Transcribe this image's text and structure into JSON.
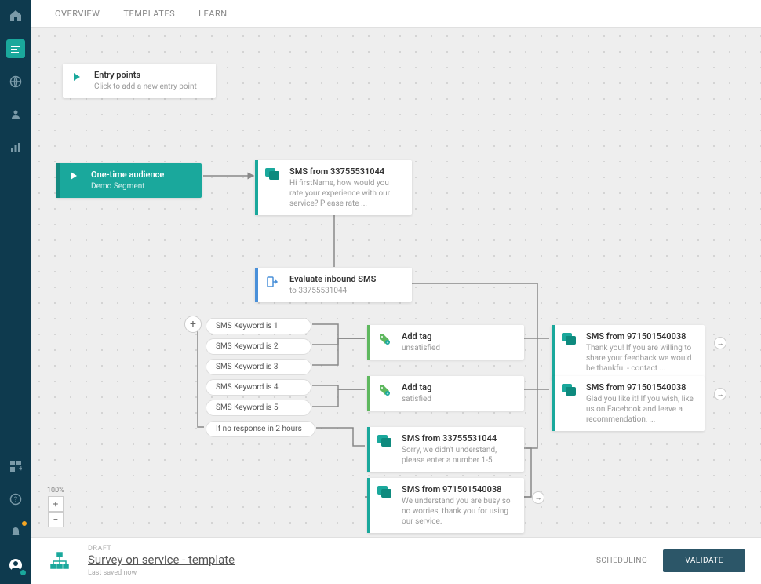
{
  "sidebar": {
    "icon_names": [
      "home",
      "flow",
      "globe",
      "users",
      "analytics"
    ],
    "bottom_icon_names": [
      "apps",
      "help",
      "notifications",
      "profile"
    ]
  },
  "tabs": [
    "OVERVIEW",
    "TEMPLATES",
    "LEARN"
  ],
  "entry_points": {
    "title": "Entry points",
    "subtitle": "Click to add a new entry point"
  },
  "nodes": {
    "audience": {
      "title": "One-time audience",
      "subtitle": "Demo Segment"
    },
    "sms1": {
      "title": "SMS from 33755531044",
      "subtitle": "Hi firstName, how would you rate your experience with our service? Please rate ..."
    },
    "evaluate": {
      "title": "Evaluate inbound SMS",
      "subtitle": "to 33755531044"
    },
    "tag1": {
      "title": "Add tag",
      "subtitle": "unsatisfied"
    },
    "tag2": {
      "title": "Add tag",
      "subtitle": "satisfied"
    },
    "sms2": {
      "title": "SMS from 971501540038",
      "subtitle": "Thank you! If you are willing to share your feedback we would be thankful - contact ..."
    },
    "sms3": {
      "title": "SMS from 971501540038",
      "subtitle": "Glad you like it! If you wish, like us on Facebook and leave a recommendation, ..."
    },
    "sms4": {
      "title": "SMS from 33755531044",
      "subtitle": "Sorry, we didn't understand, please enter a number 1-5."
    },
    "sms5": {
      "title": "SMS from 971501540038",
      "subtitle": "We understand you are busy so no worries, thank you for using our service."
    }
  },
  "branches": {
    "k1": "SMS Keyword is 1",
    "k2": "SMS Keyword is 2",
    "k3": "SMS Keyword is 3",
    "k4": "SMS Keyword is 4",
    "k5": "SMS Keyword is 5",
    "nores": "If no response in 2 hours"
  },
  "zoom": {
    "label": "100%"
  },
  "footer": {
    "status": "DRAFT",
    "title": "Survey on service - template",
    "saved": "Last saved now",
    "scheduling": "SCHEDULING",
    "validate": "VALIDATE"
  }
}
